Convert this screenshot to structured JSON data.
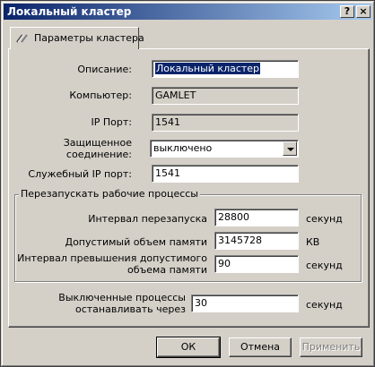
{
  "window": {
    "title": "Локальный кластер",
    "help_label": "?",
    "close_label": "×"
  },
  "tab": {
    "label": "Параметры кластера"
  },
  "fields": {
    "description": {
      "label": "Описание:",
      "value": "Локальный кластер"
    },
    "computer": {
      "label": "Компьютер:",
      "value": "GAMLET"
    },
    "ip_port": {
      "label": "IP Порт:",
      "value": "1541"
    },
    "secure_connection": {
      "label_line1": "Защищенное",
      "label_line2": "соединение:",
      "value": "выключено"
    },
    "service_ip_port": {
      "label": "Служебный IP порт:",
      "value": "1541"
    }
  },
  "restart_group": {
    "title": "Перезапускать рабочие процессы",
    "restart_interval": {
      "label": "Интервал перезапуска",
      "value": "28800",
      "unit": "секунд"
    },
    "memory_limit": {
      "label": "Допустимый объем памяти",
      "value": "3145728",
      "unit": "КВ"
    },
    "exceed_interval": {
      "label_line1": "Интервал превышения допустимого",
      "label_line2": "объема памяти",
      "value": "90",
      "unit": "секунд"
    }
  },
  "disabled_processes": {
    "label_line1": "Выключенные процессы",
    "label_line2": "останавливать через",
    "value": "30",
    "unit": "секунд"
  },
  "buttons": {
    "ok": "ОК",
    "cancel": "Отмена",
    "apply": "Применить"
  }
}
